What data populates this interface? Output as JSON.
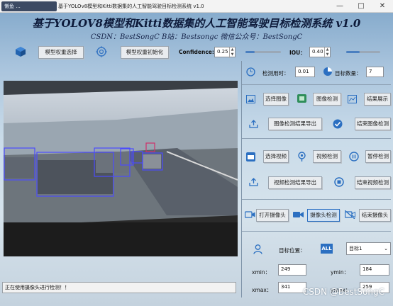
{
  "window": {
    "app_badge": "懒鱼 ...",
    "title": "基于YOLOv8模型和Kitti数据集的人工智能驾驶目标检测系统 v1.0",
    "controls": [
      "—",
      "□",
      "✕"
    ]
  },
  "header": {
    "title": "基于YOLOV8模型和Kitti数据集的人工智能驾驶目标检测系统 v1.0",
    "subtitle": "CSDN：BestSongC   B站：Bestsongc   微信公众号：BestSongC"
  },
  "model_bar": {
    "select_weights": "模型权重选择",
    "init_weights": "模型权重初始化",
    "confidence_label": "Confidence:",
    "confidence_value": "0.25",
    "confidence_level": 0.25,
    "iou_label": "IOU：",
    "iou_value": "0.40",
    "iou_level": 0.4
  },
  "stats": {
    "time_label": "检测用时：",
    "time_value": "0.01",
    "count_label": "目标数量：",
    "count_value": "7"
  },
  "image_section": {
    "select_image": "选择图像",
    "image_detect": "图像检测",
    "show_results": "结果展示",
    "export_image": "图像检测结果导出",
    "end_image": "结束图像检测"
  },
  "video_section": {
    "select_video": "选择视频",
    "video_detect": "视频检测",
    "pause": "暂停检测",
    "export_video": "视频检测结果导出",
    "end_video": "结束视频检测"
  },
  "camera_section": {
    "open_camera": "打开摄像头",
    "camera_detect": "摄像头检测",
    "close_camera": "结束摄像头"
  },
  "target": {
    "position_label": "目标位置：",
    "selected": "目标1",
    "all_icon": "ALL",
    "xmin_label": "xmin：",
    "xmin_value": "249",
    "ymin_label": "ymin：",
    "ymin_value": "184",
    "xmax_label": "xmax：",
    "xmax_value": "341",
    "ymax_label": "ymax：",
    "ymax_value": "259"
  },
  "status": {
    "message": "正在使用摄像头进行检测！！"
  },
  "watermark": "CSDN @BestSongC",
  "colors": {
    "accent": "#2b6fc1",
    "box": "#4b4bff",
    "box_highlight": "#d0306a"
  }
}
